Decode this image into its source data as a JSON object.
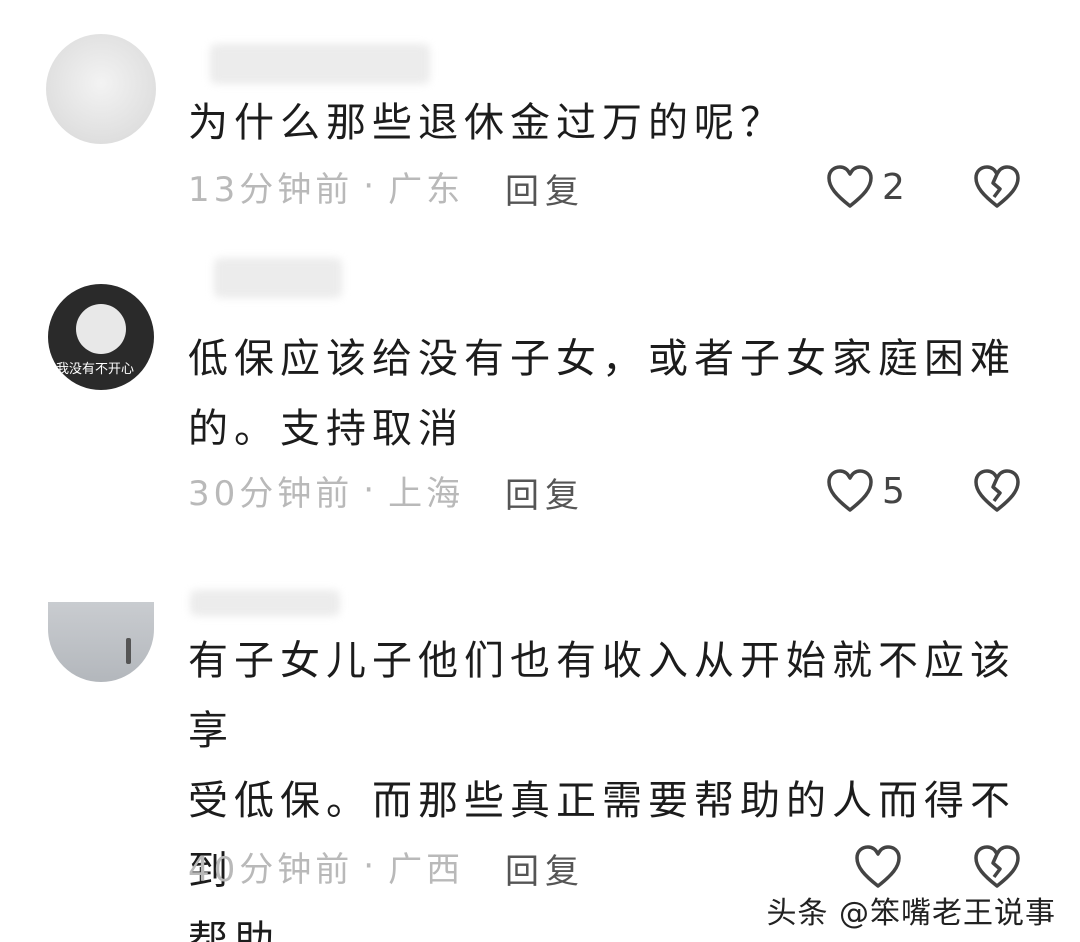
{
  "comments": [
    {
      "text_lines": [
        "为什么那些退休金过万的呢？"
      ],
      "time": "13分钟前",
      "location": "广东",
      "reply_label": "回复",
      "likes": "2"
    },
    {
      "text_lines": [
        "低保应该给没有子女，或者子女家庭困难",
        "的。支持取消"
      ],
      "avatar_caption": "我没有不开心",
      "time": "30分钟前",
      "location": "上海",
      "reply_label": "回复",
      "likes": "5"
    },
    {
      "text_lines": [
        "有子女儿子他们也有收入从开始就不应该享",
        "受低保。而那些真正需要帮助的人而得不到",
        "帮助"
      ],
      "time": "40分钟前",
      "location": "广西",
      "reply_label": "回复",
      "likes": ""
    }
  ],
  "separator": "·",
  "watermark": "头条 @笨嘴老王说事",
  "colors": {
    "meta": "#b9b9b9",
    "text": "#1c1c1c",
    "icon": "#444444"
  }
}
